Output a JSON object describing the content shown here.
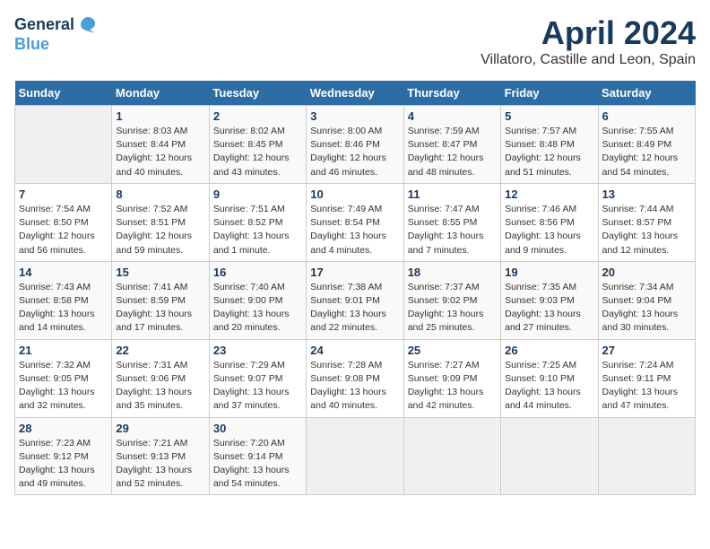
{
  "logo": {
    "line1": "General",
    "line2": "Blue"
  },
  "title": "April 2024",
  "subtitle": "Villatoro, Castille and Leon, Spain",
  "days_header": [
    "Sunday",
    "Monday",
    "Tuesday",
    "Wednesday",
    "Thursday",
    "Friday",
    "Saturday"
  ],
  "weeks": [
    [
      {
        "num": "",
        "sunrise": "",
        "sunset": "",
        "daylight": ""
      },
      {
        "num": "1",
        "sunrise": "Sunrise: 8:03 AM",
        "sunset": "Sunset: 8:44 PM",
        "daylight": "Daylight: 12 hours and 40 minutes."
      },
      {
        "num": "2",
        "sunrise": "Sunrise: 8:02 AM",
        "sunset": "Sunset: 8:45 PM",
        "daylight": "Daylight: 12 hours and 43 minutes."
      },
      {
        "num": "3",
        "sunrise": "Sunrise: 8:00 AM",
        "sunset": "Sunset: 8:46 PM",
        "daylight": "Daylight: 12 hours and 46 minutes."
      },
      {
        "num": "4",
        "sunrise": "Sunrise: 7:59 AM",
        "sunset": "Sunset: 8:47 PM",
        "daylight": "Daylight: 12 hours and 48 minutes."
      },
      {
        "num": "5",
        "sunrise": "Sunrise: 7:57 AM",
        "sunset": "Sunset: 8:48 PM",
        "daylight": "Daylight: 12 hours and 51 minutes."
      },
      {
        "num": "6",
        "sunrise": "Sunrise: 7:55 AM",
        "sunset": "Sunset: 8:49 PM",
        "daylight": "Daylight: 12 hours and 54 minutes."
      }
    ],
    [
      {
        "num": "7",
        "sunrise": "Sunrise: 7:54 AM",
        "sunset": "Sunset: 8:50 PM",
        "daylight": "Daylight: 12 hours and 56 minutes."
      },
      {
        "num": "8",
        "sunrise": "Sunrise: 7:52 AM",
        "sunset": "Sunset: 8:51 PM",
        "daylight": "Daylight: 12 hours and 59 minutes."
      },
      {
        "num": "9",
        "sunrise": "Sunrise: 7:51 AM",
        "sunset": "Sunset: 8:52 PM",
        "daylight": "Daylight: 13 hours and 1 minute."
      },
      {
        "num": "10",
        "sunrise": "Sunrise: 7:49 AM",
        "sunset": "Sunset: 8:54 PM",
        "daylight": "Daylight: 13 hours and 4 minutes."
      },
      {
        "num": "11",
        "sunrise": "Sunrise: 7:47 AM",
        "sunset": "Sunset: 8:55 PM",
        "daylight": "Daylight: 13 hours and 7 minutes."
      },
      {
        "num": "12",
        "sunrise": "Sunrise: 7:46 AM",
        "sunset": "Sunset: 8:56 PM",
        "daylight": "Daylight: 13 hours and 9 minutes."
      },
      {
        "num": "13",
        "sunrise": "Sunrise: 7:44 AM",
        "sunset": "Sunset: 8:57 PM",
        "daylight": "Daylight: 13 hours and 12 minutes."
      }
    ],
    [
      {
        "num": "14",
        "sunrise": "Sunrise: 7:43 AM",
        "sunset": "Sunset: 8:58 PM",
        "daylight": "Daylight: 13 hours and 14 minutes."
      },
      {
        "num": "15",
        "sunrise": "Sunrise: 7:41 AM",
        "sunset": "Sunset: 8:59 PM",
        "daylight": "Daylight: 13 hours and 17 minutes."
      },
      {
        "num": "16",
        "sunrise": "Sunrise: 7:40 AM",
        "sunset": "Sunset: 9:00 PM",
        "daylight": "Daylight: 13 hours and 20 minutes."
      },
      {
        "num": "17",
        "sunrise": "Sunrise: 7:38 AM",
        "sunset": "Sunset: 9:01 PM",
        "daylight": "Daylight: 13 hours and 22 minutes."
      },
      {
        "num": "18",
        "sunrise": "Sunrise: 7:37 AM",
        "sunset": "Sunset: 9:02 PM",
        "daylight": "Daylight: 13 hours and 25 minutes."
      },
      {
        "num": "19",
        "sunrise": "Sunrise: 7:35 AM",
        "sunset": "Sunset: 9:03 PM",
        "daylight": "Daylight: 13 hours and 27 minutes."
      },
      {
        "num": "20",
        "sunrise": "Sunrise: 7:34 AM",
        "sunset": "Sunset: 9:04 PM",
        "daylight": "Daylight: 13 hours and 30 minutes."
      }
    ],
    [
      {
        "num": "21",
        "sunrise": "Sunrise: 7:32 AM",
        "sunset": "Sunset: 9:05 PM",
        "daylight": "Daylight: 13 hours and 32 minutes."
      },
      {
        "num": "22",
        "sunrise": "Sunrise: 7:31 AM",
        "sunset": "Sunset: 9:06 PM",
        "daylight": "Daylight: 13 hours and 35 minutes."
      },
      {
        "num": "23",
        "sunrise": "Sunrise: 7:29 AM",
        "sunset": "Sunset: 9:07 PM",
        "daylight": "Daylight: 13 hours and 37 minutes."
      },
      {
        "num": "24",
        "sunrise": "Sunrise: 7:28 AM",
        "sunset": "Sunset: 9:08 PM",
        "daylight": "Daylight: 13 hours and 40 minutes."
      },
      {
        "num": "25",
        "sunrise": "Sunrise: 7:27 AM",
        "sunset": "Sunset: 9:09 PM",
        "daylight": "Daylight: 13 hours and 42 minutes."
      },
      {
        "num": "26",
        "sunrise": "Sunrise: 7:25 AM",
        "sunset": "Sunset: 9:10 PM",
        "daylight": "Daylight: 13 hours and 44 minutes."
      },
      {
        "num": "27",
        "sunrise": "Sunrise: 7:24 AM",
        "sunset": "Sunset: 9:11 PM",
        "daylight": "Daylight: 13 hours and 47 minutes."
      }
    ],
    [
      {
        "num": "28",
        "sunrise": "Sunrise: 7:23 AM",
        "sunset": "Sunset: 9:12 PM",
        "daylight": "Daylight: 13 hours and 49 minutes."
      },
      {
        "num": "29",
        "sunrise": "Sunrise: 7:21 AM",
        "sunset": "Sunset: 9:13 PM",
        "daylight": "Daylight: 13 hours and 52 minutes."
      },
      {
        "num": "30",
        "sunrise": "Sunrise: 7:20 AM",
        "sunset": "Sunset: 9:14 PM",
        "daylight": "Daylight: 13 hours and 54 minutes."
      },
      {
        "num": "",
        "sunrise": "",
        "sunset": "",
        "daylight": ""
      },
      {
        "num": "",
        "sunrise": "",
        "sunset": "",
        "daylight": ""
      },
      {
        "num": "",
        "sunrise": "",
        "sunset": "",
        "daylight": ""
      },
      {
        "num": "",
        "sunrise": "",
        "sunset": "",
        "daylight": ""
      }
    ]
  ]
}
